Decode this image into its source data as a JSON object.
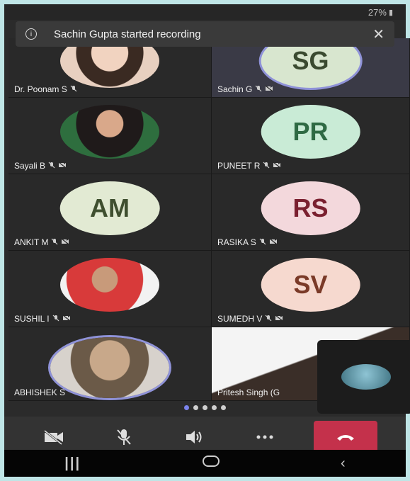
{
  "status": {
    "battery": "27%"
  },
  "banner": {
    "message": "Sachin Gupta started recording",
    "close_glyph": "✕"
  },
  "participants": [
    {
      "name": "Dr. Poonam S",
      "initials": "",
      "photo": true
    },
    {
      "name": "Sachin G",
      "initials": "SG",
      "avatar_bg": "#d8e6cf",
      "avatar_fg": "#3a4a30",
      "highlight": true
    },
    {
      "name": "Sayali B",
      "initials": "",
      "photo": true
    },
    {
      "name": "PUNEET R",
      "initials": "PR",
      "avatar_bg": "#c9ebd6",
      "avatar_fg": "#2f6a44"
    },
    {
      "name": "ANKIT M",
      "initials": "AM",
      "avatar_bg": "#e2ead3",
      "avatar_fg": "#3f4f2f"
    },
    {
      "name": "RASIKA S",
      "initials": "RS",
      "avatar_bg": "#f3d8dc",
      "avatar_fg": "#7a2030"
    },
    {
      "name": "SUSHIL I",
      "initials": "",
      "photo": true
    },
    {
      "name": "SUMEDH V",
      "initials": "SV",
      "avatar_bg": "#f6d9cf",
      "avatar_fg": "#7a3a28"
    },
    {
      "name": "ABHISHEK S",
      "initials": "",
      "photo": true
    },
    {
      "name": "Pritesh Singh (G",
      "initials": "",
      "photo": true
    }
  ],
  "icons": {
    "mic_off": "mic-off-icon",
    "video_off": "video-off-icon"
  },
  "pagination": {
    "count": 5,
    "active_index": 0
  },
  "controls": {
    "camera": "camera-off-icon",
    "mic": "mic-off-icon",
    "speaker": "speaker-icon",
    "more": "more-icon",
    "end": "end-call-icon"
  },
  "colors": {
    "end_call": "#c4314b",
    "active_dot": "#7b83eb"
  }
}
